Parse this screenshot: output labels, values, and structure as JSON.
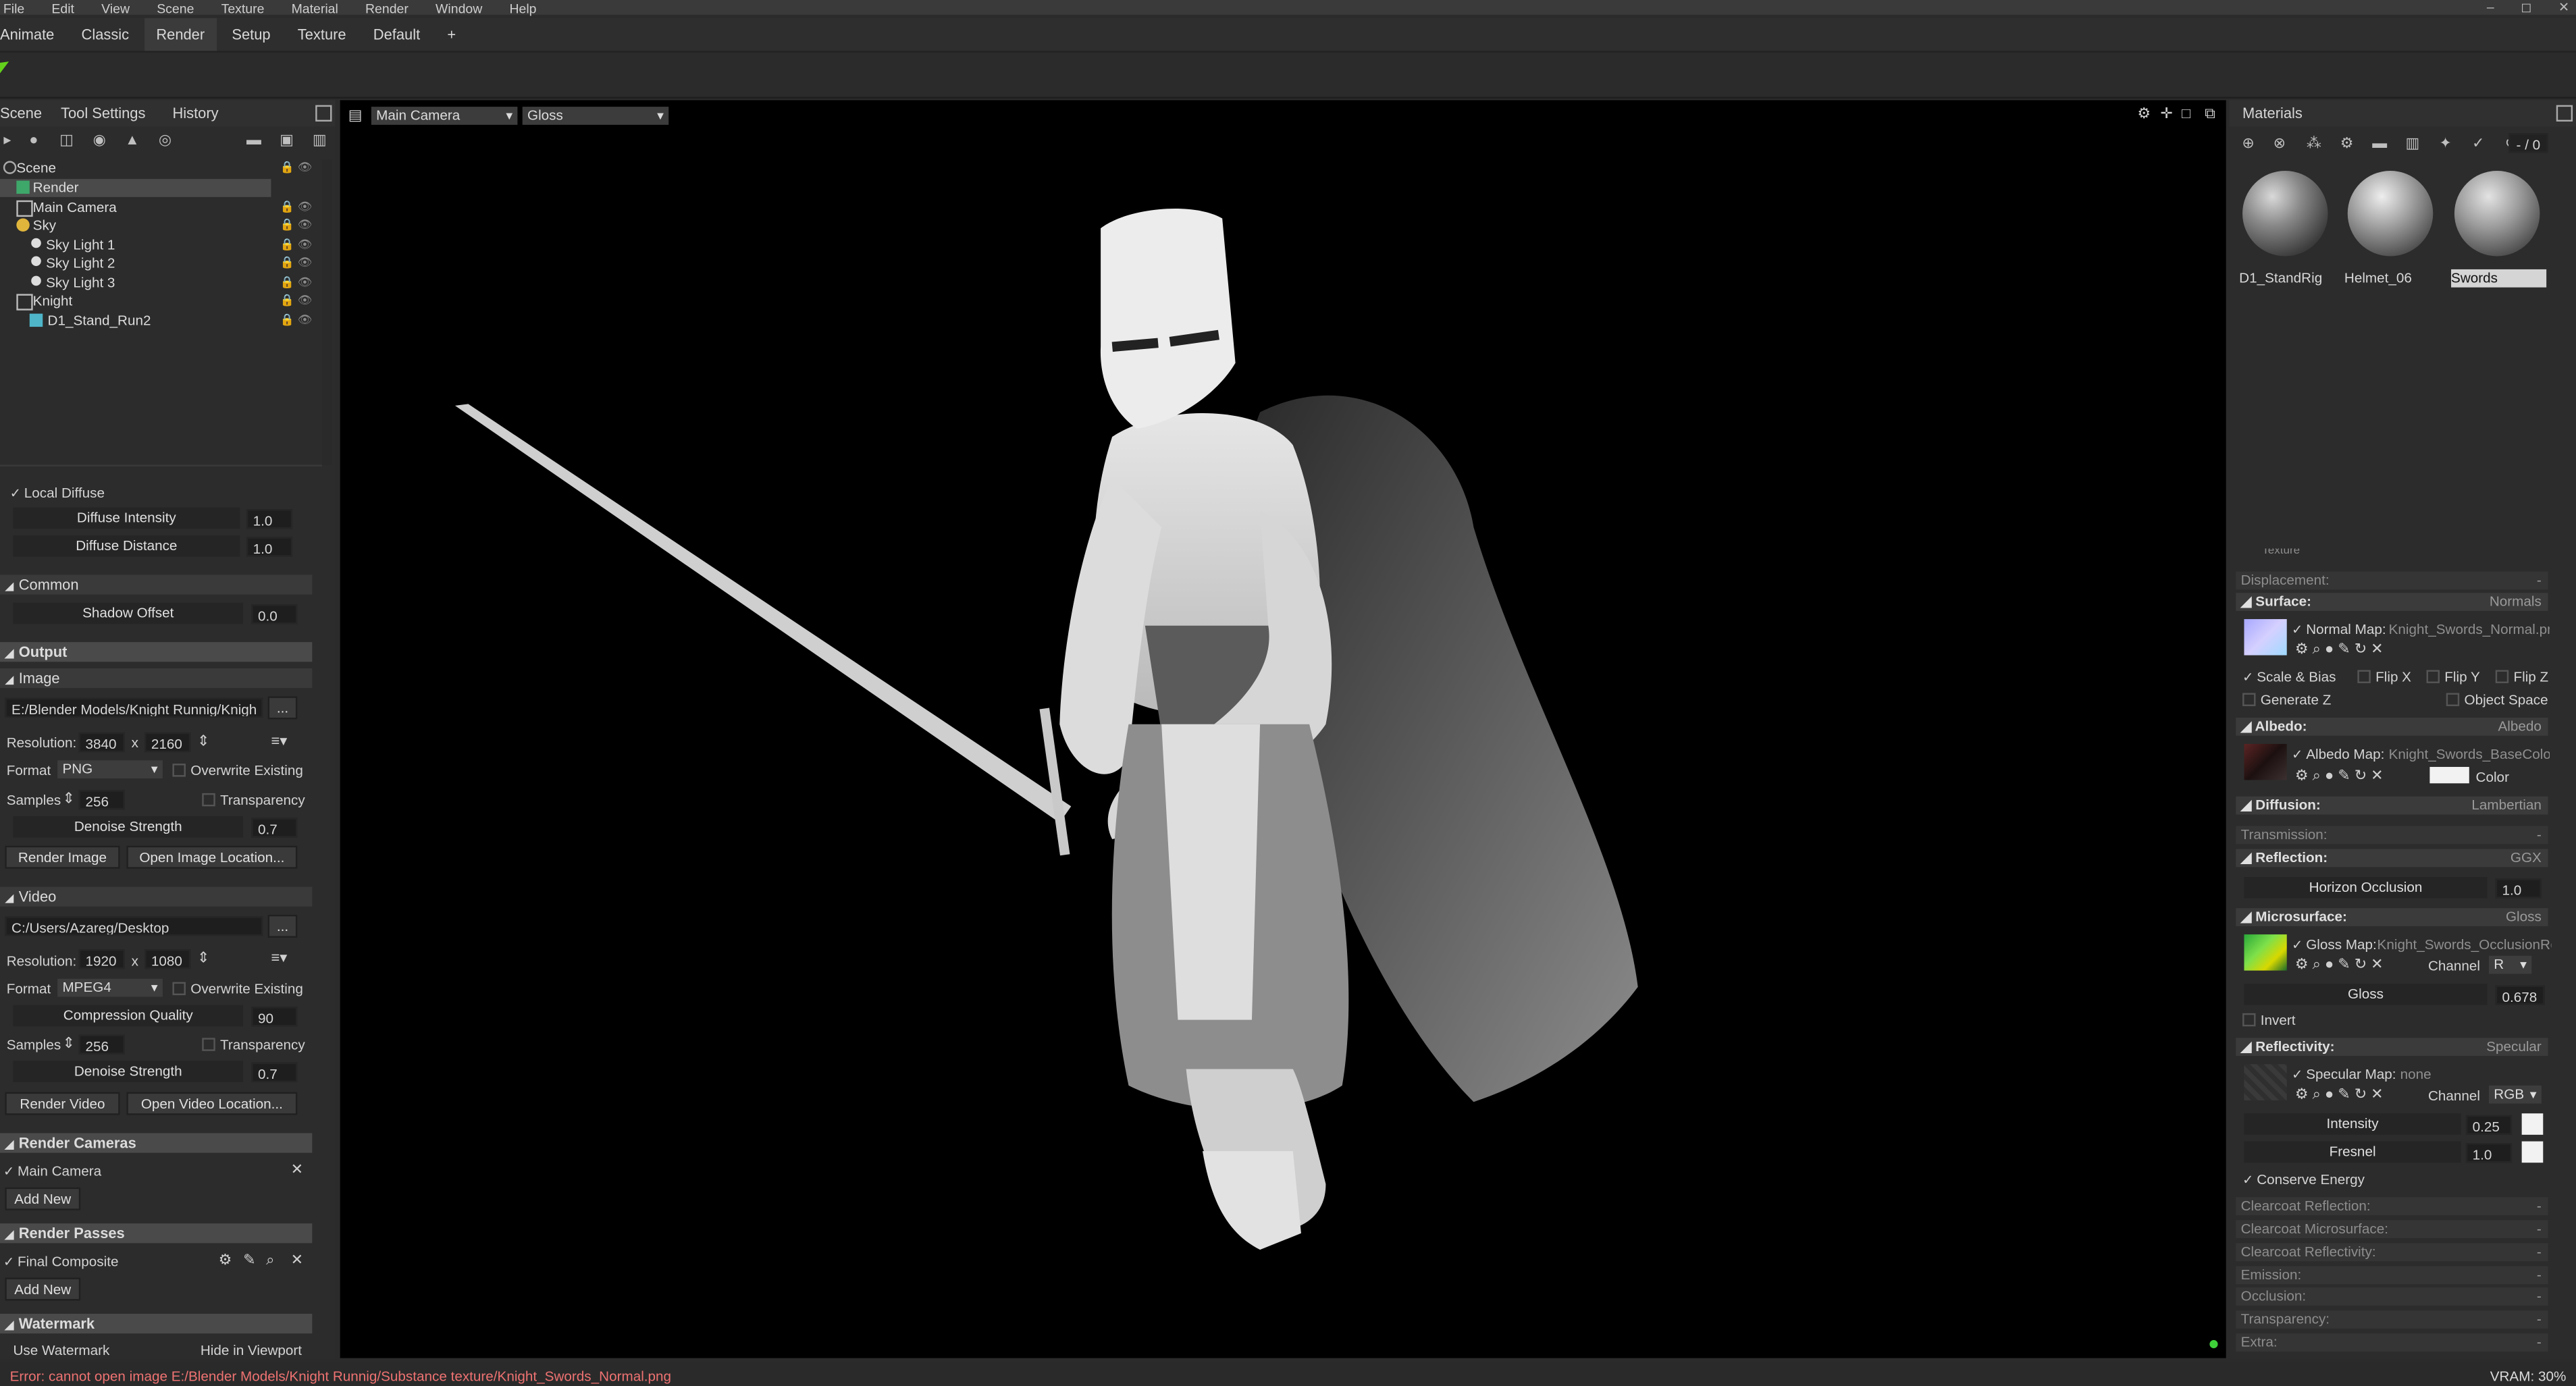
{
  "menu": [
    "File",
    "Edit",
    "View",
    "Scene",
    "Texture",
    "Material",
    "Render",
    "Window",
    "Help"
  ],
  "window_controls": [
    "–",
    "◻",
    "✕"
  ],
  "workspace_tabs": [
    "Animate",
    "Classic",
    "Render",
    "Setup",
    "Texture",
    "Default",
    "+"
  ],
  "left_tabs": {
    "scene": "Scene",
    "tool_settings": "Tool Settings",
    "history": "History"
  },
  "scene_tree": [
    {
      "label": "Scene",
      "indent": 0
    },
    {
      "label": "Render",
      "indent": 1
    },
    {
      "label": "Main Camera",
      "indent": 1
    },
    {
      "label": "Sky",
      "indent": 1
    },
    {
      "label": "Sky Light 1",
      "indent": 2
    },
    {
      "label": "Sky Light 2",
      "indent": 2
    },
    {
      "label": "Sky Light 3",
      "indent": 2
    },
    {
      "label": "Knight",
      "indent": 1
    },
    {
      "label": "D1_Stand_Run2",
      "indent": 2
    }
  ],
  "props": {
    "local_diffuse": "Local Diffuse",
    "diffuse_intensity": {
      "label": "Diffuse Intensity",
      "value": "1.0"
    },
    "diffuse_distance": {
      "label": "Diffuse Distance",
      "value": "1.0"
    },
    "common": "Common",
    "shadow_offset": {
      "label": "Shadow Offset",
      "value": "0.0"
    },
    "output": "Output",
    "image": "Image",
    "image_path": "E:/Blender Models/Knight Runnig/Knigh",
    "browse": "...",
    "resolution_label": "Resolution:",
    "image_res_w": "3840",
    "image_res_h": "2160",
    "x": "x",
    "format_label": "Format",
    "image_format": "PNG",
    "overwrite": "Overwrite Existing",
    "samples_label": "Samples",
    "image_samples": "256",
    "transparency": "Transparency",
    "denoise_strength": {
      "label": "Denoise Strength",
      "value": "0.7"
    },
    "render_image": "Render Image",
    "open_image_location": "Open Image Location...",
    "video": "Video",
    "video_path": "C:/Users/Azareg/Desktop",
    "video_res_w": "1920",
    "video_res_h": "1080",
    "video_format": "MPEG4",
    "compression_quality": {
      "label": "Compression Quality",
      "value": "90"
    },
    "video_samples": "256",
    "video_denoise": {
      "label": "Denoise Strength",
      "value": "0.7"
    },
    "render_video": "Render Video",
    "open_video_location": "Open Video Location...",
    "render_cameras": "Render Cameras",
    "main_camera": "Main Camera",
    "add_new": "Add New",
    "render_passes": "Render Passes",
    "final_composite": "Final Composite",
    "watermark": "Watermark",
    "use_watermark": "Use Watermark",
    "hide_in_viewport": "Hide in Viewport"
  },
  "viewport": {
    "camera": "Main Camera",
    "shading": "Gloss"
  },
  "materials": {
    "title": "Materials",
    "page": "- / 0",
    "thumbs": [
      "D1_StandRig",
      "Helmet_06",
      "Swords"
    ],
    "cut_section": "Texture",
    "displacement": {
      "label": "Displacement:",
      "value": "-"
    },
    "surface": {
      "label": "Surface:",
      "value": "Normals"
    },
    "normal_map": {
      "label": "Normal Map:",
      "file": "Knight_Swords_Normal.png"
    },
    "scale_bias": "Scale & Bias",
    "flip_x": "Flip X",
    "flip_y": "Flip Y",
    "flip_z": "Flip Z",
    "generate_z": "Generate Z",
    "object_space": "Object Space",
    "albedo": {
      "label": "Albedo:",
      "value": "Albedo"
    },
    "albedo_map": {
      "label": "Albedo Map:",
      "file": "Knight_Swords_BaseColor.png"
    },
    "color": "Color",
    "diffusion": {
      "label": "Diffusion:",
      "value": "Lambertian"
    },
    "transmission": {
      "label": "Transmission:",
      "value": "-"
    },
    "reflection": {
      "label": "Reflection:",
      "value": "GGX"
    },
    "horizon_occlusion": {
      "label": "Horizon Occlusion",
      "value": "1.0"
    },
    "microsurface": {
      "label": "Microsurface:",
      "value": "Gloss"
    },
    "gloss_map": {
      "label": "Gloss Map:",
      "file": "Knight_Swords_OcclusionRo"
    },
    "channel": "Channel",
    "channel_r": "R",
    "gloss": {
      "label": "Gloss",
      "value": "0.678"
    },
    "invert": "Invert",
    "reflectivity": {
      "label": "Reflectivity:",
      "value": "Specular"
    },
    "specular_map": {
      "label": "Specular Map:",
      "file": "none"
    },
    "channel_rgb": "RGB",
    "intensity": {
      "label": "Intensity",
      "value": "0.25"
    },
    "fresnel": {
      "label": "Fresnel",
      "value": "1.0"
    },
    "conserve_energy": "Conserve Energy",
    "extra_sections": [
      {
        "label": "Clearcoat Reflection:",
        "value": "-"
      },
      {
        "label": "Clearcoat Microsurface:",
        "value": "-"
      },
      {
        "label": "Clearcoat Reflectivity:",
        "value": "-"
      },
      {
        "label": "Emission:",
        "value": "-"
      },
      {
        "label": "Occlusion:",
        "value": "-"
      },
      {
        "label": "Transparency:",
        "value": "-"
      },
      {
        "label": "Extra:",
        "value": "-"
      }
    ]
  },
  "status": {
    "error": "Error: cannot open image E:/Blender Models/Knight Runnig/Substance texture/Knight_Swords_Normal.png",
    "vram": "VRAM: 30%"
  },
  "colors": {
    "accent_green": "#63d11b",
    "error": "#ef7272",
    "selected_row": "#4a4a4a"
  }
}
